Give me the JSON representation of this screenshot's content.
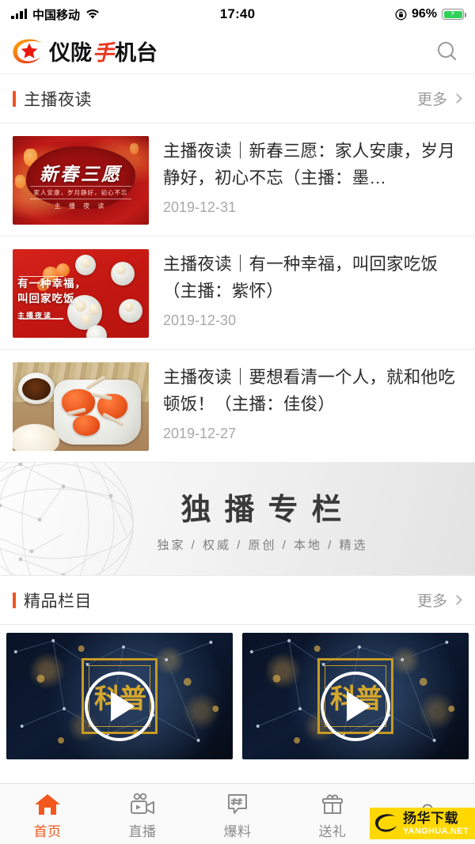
{
  "status_bar": {
    "carrier": "中国移动",
    "time": "17:40",
    "battery_percent": "96%",
    "icons": {
      "signal": "signal-bars-icon",
      "wifi": "wifi-icon",
      "rotation_lock": "rotation-lock-icon",
      "battery": "battery-charging-icon"
    }
  },
  "header": {
    "logo_text_1": "仪陇",
    "logo_text_hand": "手",
    "logo_text_2": "机台",
    "logo_mark": "star-swoosh-logo-icon",
    "search": "search-icon"
  },
  "sections": [
    {
      "title": "主播夜读",
      "more_label": "更多",
      "accent": "#ef5423"
    },
    {
      "title": "精品栏目",
      "more_label": "更多",
      "accent": "#ef5423"
    }
  ],
  "news": [
    {
      "title": "主播夜读｜新春三愿：家人安康，岁月静好，初心不忘（主播：墨…",
      "date": "2019-12-31",
      "thumb": {
        "style": "t1",
        "headline": "新春三愿",
        "subline": "家人安康，岁月静好，初心不忘",
        "tag": "主 播 夜 读"
      }
    },
    {
      "title": "主播夜读｜有一种幸福，叫回家吃饭（主播：紫怀）",
      "date": "2019-12-30",
      "thumb": {
        "style": "t2",
        "line1": "有一种幸福，",
        "line2": "叫回家吃饭",
        "tag": "主播夜读"
      }
    },
    {
      "title": "主播夜读｜要想看清一个人，就和他吃顿饭！（主播：佳俊）",
      "date": "2019-12-27",
      "thumb": {
        "style": "t3"
      }
    }
  ],
  "banner": {
    "title": "独播专栏",
    "subtitle": "独家 / 权威 / 原创 / 本地 / 精选",
    "art": "globe-network-icon"
  },
  "videos": [
    {
      "emblem": "科普",
      "play": "play-icon"
    },
    {
      "emblem": "科普",
      "play": "play-icon"
    }
  ],
  "tab_bar": {
    "items": [
      {
        "label": "首页",
        "icon": "home-icon",
        "active": true
      },
      {
        "label": "直播",
        "icon": "video-camera-icon",
        "active": false
      },
      {
        "label": "爆料",
        "icon": "hashtag-bubble-icon",
        "active": false
      },
      {
        "label": "送礼",
        "icon": "gift-icon",
        "active": false
      },
      {
        "label": "",
        "icon": "user-icon",
        "active": false
      }
    ],
    "active_color": "#f2581e",
    "inactive_color": "#8c8c8c"
  },
  "watermark": {
    "cn": "扬华下载",
    "en": "YANGHUA.NET",
    "icon": "yanghua-globe-icon",
    "bg": "#ffd800"
  }
}
